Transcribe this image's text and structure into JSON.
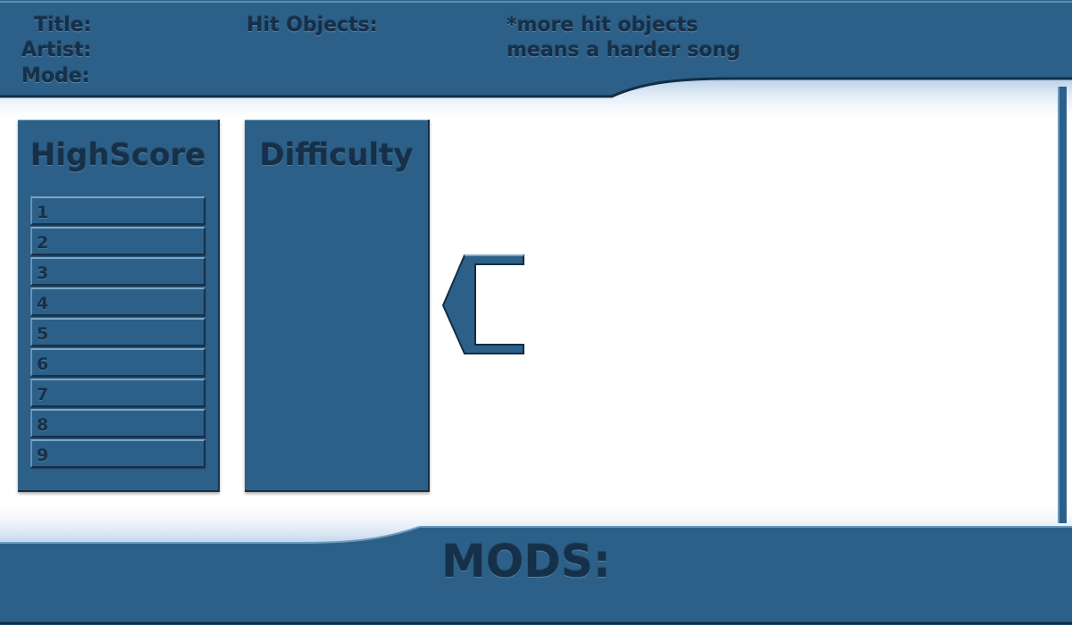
{
  "header": {
    "title_label": "Title:",
    "artist_label": "Artist:",
    "mode_label": "Mode:",
    "hit_objects_label": "Hit Objects:",
    "note_line1": "*more hit objects",
    "note_line2": "means a harder song"
  },
  "highscore": {
    "title": "HighScore",
    "rows": [
      "1",
      "2",
      "3",
      "4",
      "5",
      "6",
      "7",
      "8",
      "9"
    ]
  },
  "difficulty": {
    "title": "Difficulty"
  },
  "mods": {
    "label": "MODS:"
  },
  "colors": {
    "panel": "#2c6088",
    "text_dark": "#16304a",
    "glow": "#cfe0f2",
    "background": "#ffffff"
  },
  "icons": {
    "back": "back-arrow-icon"
  }
}
